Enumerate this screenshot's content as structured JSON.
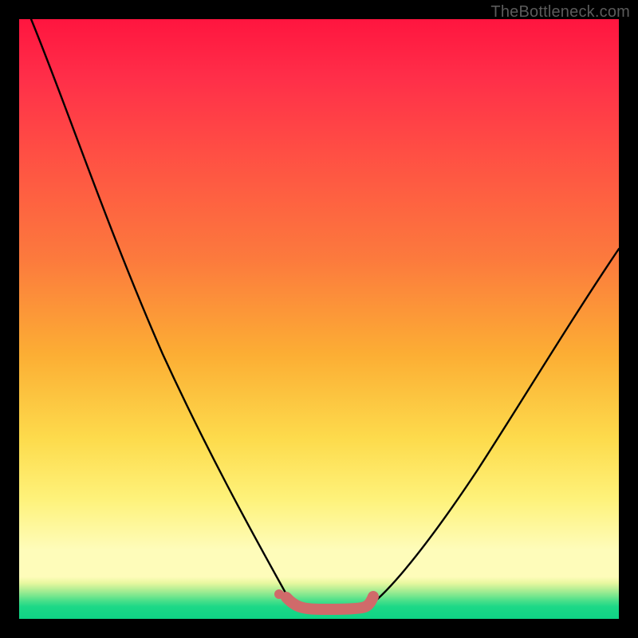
{
  "watermark": "TheBottleneck.com",
  "chart_data": {
    "type": "line",
    "title": "",
    "xlabel": "",
    "ylabel": "",
    "xlim": [
      0,
      100
    ],
    "ylim": [
      0,
      100
    ],
    "grid": false,
    "legend": false,
    "series": [
      {
        "name": "left-curve",
        "color": "#000000",
        "x": [
          2,
          6,
          10,
          14,
          18,
          22,
          26,
          30,
          34,
          38,
          42,
          43.5,
          45
        ],
        "y": [
          100,
          88,
          76,
          64,
          53,
          43,
          34,
          26,
          19,
          13,
          7,
          4,
          2
        ]
      },
      {
        "name": "right-curve",
        "color": "#000000",
        "x": [
          58,
          60,
          64,
          68,
          72,
          76,
          80,
          84,
          88,
          92,
          96,
          100
        ],
        "y": [
          2,
          3.5,
          8,
          13,
          18,
          24,
          30,
          36,
          42,
          48,
          55,
          62
        ]
      },
      {
        "name": "bottom-segment",
        "color": "#d06a6a",
        "x": [
          44,
          46,
          50,
          54,
          57,
          58
        ],
        "y": [
          3.7,
          2.2,
          2,
          2,
          2.2,
          4
        ]
      }
    ],
    "markers": [
      {
        "name": "left-dot",
        "x": 43.2,
        "y": 4.2,
        "color": "#d06a6a",
        "r": 6
      }
    ]
  }
}
